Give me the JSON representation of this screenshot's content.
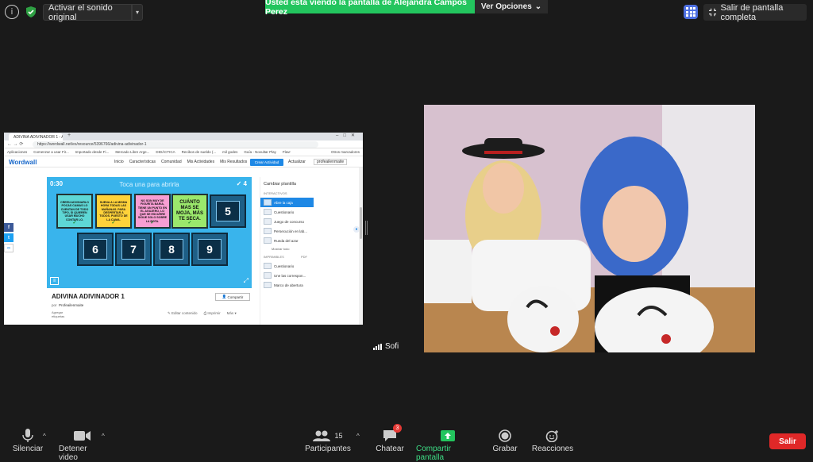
{
  "top": {
    "audio_label": "Activar el sonido original",
    "viewing_text": "Usted está viendo la pantalla de Alejandra Campos Perez",
    "view_options": "Ver Opciones",
    "exit_fullscreen": "Salir de pantalla completa"
  },
  "shared_screen": {
    "browser_tab": "ADIVINA ADIVINADOR 1 - Ade",
    "url": "https://wordwall.net/es/resource/5396766/adivina-adivinador-1",
    "bookmarks": [
      "Aplicaciones",
      "Comenzar a usar Fir...",
      "Importado desde Fi...",
      "Mercado Libre Arge...",
      "DIDÁCTICA",
      "Recibos de sueldo (...",
      "mil godes",
      "Guía - Novultar Play",
      "Flavr",
      "Otros marcadores"
    ],
    "site": {
      "logo": "Wordwall",
      "nav": [
        "Inicio",
        "Características",
        "Comunidad",
        "Mis Actividades",
        "Mis Resultados"
      ],
      "create": "Crear Actividad",
      "login": "Actualizar",
      "user": "profeailenmaite"
    },
    "game": {
      "timer": "0:30",
      "title": "Toca una para abrirla",
      "count": "4",
      "cards": [
        "CREEN ADIVINARLO POCAS CAMAS LO CUENTAN DE TODO TIPO, SI QUIEREN USAR MUCHO CONTAR LO.",
        "SUENA A LA MISMA HORA TODAS LAS MAÑANAS. PARA DESPERTAR A TODOS. PUESTO DE LA CAMA.",
        "NO SON MUY DE FIGURITA BARIA, TIENE UN PUNTO EN EL AGUJERO, LO QUE SE ESCURRE SIGUE SOLO SOBRE LA BOTA.",
        "CUÁNTO MAS SE MOJA, MÁS TE SECA."
      ],
      "numbers": [
        "5",
        "6",
        "7",
        "8",
        "9"
      ]
    },
    "side_panel": {
      "header": "Cambiar plantilla",
      "section1": "INTERACTIVOS",
      "templates": [
        "Abre la caja",
        "Cuestionario",
        "Juego de concurso",
        "Persecución en lab...",
        "Rueda del azar"
      ],
      "more": "Mostrar todo",
      "section2": "IMPRIMIBLES",
      "section2_tag": "PDF",
      "printables": [
        "Cuestionario",
        "Une las correspon...",
        "Marco de abertura"
      ]
    },
    "activity": {
      "title": "ADIVINA ADIVINADOR 1",
      "share": "Compartir",
      "by_label": "por",
      "author": "Profeailenmaite",
      "embed": "Agregar etiquetas",
      "tools": [
        "Editar contenido",
        "Imprimir",
        "Más"
      ]
    }
  },
  "video": {
    "participant_name": "Sofi"
  },
  "toolbar": {
    "mute": "Silenciar",
    "stop_video": "Detener video",
    "participants": "Participantes",
    "participants_count": "15",
    "chat": "Chatear",
    "chat_badge": "3",
    "share_screen": "Compartir pantalla",
    "record": "Grabar",
    "reactions": "Reacciones",
    "leave": "Salir"
  },
  "colors": {
    "viewing_banner": "#23c55e",
    "leave_button": "#e02828",
    "share_icon": "#23c55e",
    "game_bg": "#39b4ec"
  }
}
